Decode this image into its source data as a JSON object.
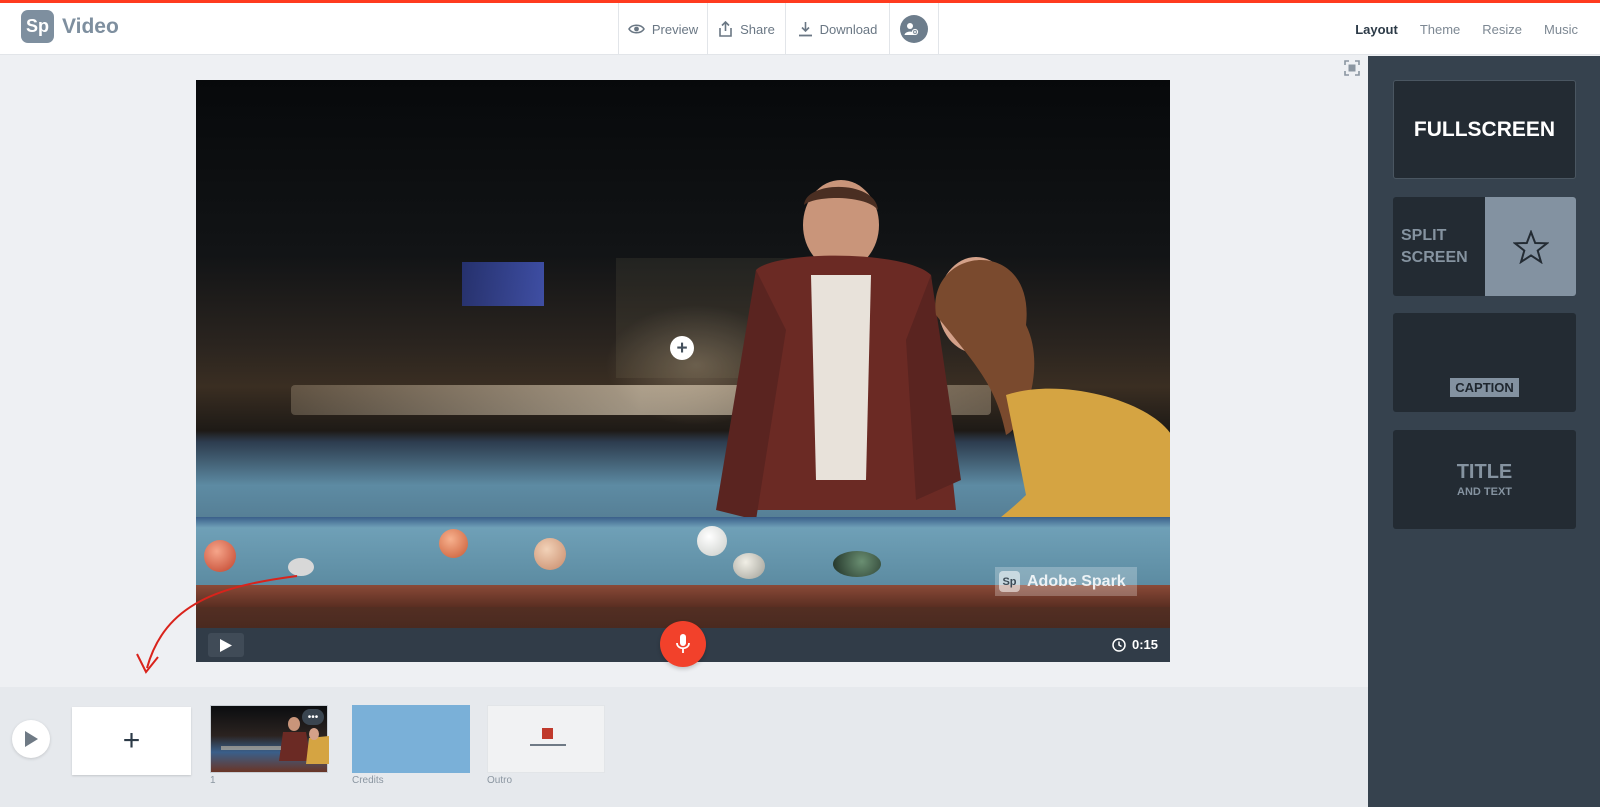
{
  "app": {
    "logo_badge": "Sp",
    "logo_text": "Video"
  },
  "toolbar": {
    "preview_label": "Preview",
    "share_label": "Share",
    "download_label": "Download"
  },
  "tabs": [
    {
      "label": "Layout",
      "active": true
    },
    {
      "label": "Theme",
      "active": false
    },
    {
      "label": "Resize",
      "active": false
    },
    {
      "label": "Music",
      "active": false
    }
  ],
  "video": {
    "watermark_badge": "Sp",
    "watermark_text": "Adobe Spark",
    "time": "0:15"
  },
  "timeline": {
    "add_label": "+",
    "items": [
      {
        "caption": "1",
        "more": "•••"
      },
      {
        "caption": "Credits"
      },
      {
        "caption": "Outro"
      }
    ]
  },
  "layouts": {
    "fullscreen": "FULLSCREEN",
    "split_line1": "SPLIT",
    "split_line2": "SCREEN",
    "caption": "CAPTION",
    "title": "TITLE",
    "title_sub": "AND TEXT"
  },
  "colors": {
    "accent_red": "#f2412b",
    "sidebar_bg": "#36424e",
    "credits_blue": "#7ab0d8"
  }
}
